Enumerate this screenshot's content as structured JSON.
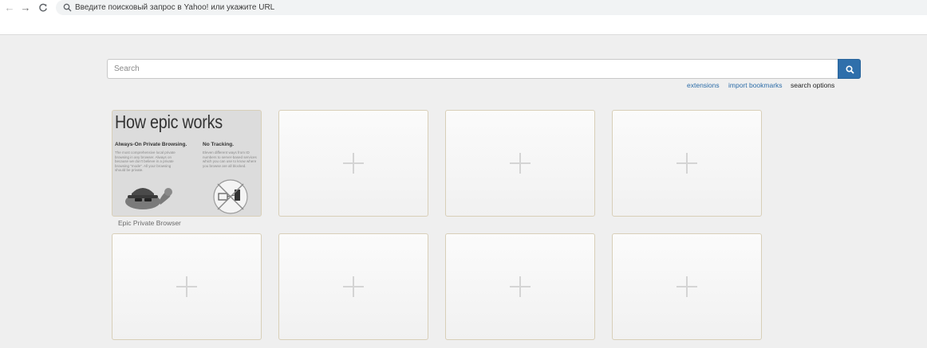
{
  "browser": {
    "address_placeholder": "Введите поисковый запрос в Yahoo! или укажите URL"
  },
  "search": {
    "placeholder": "Search"
  },
  "links": {
    "extensions": "extensions",
    "import_bookmarks": "import bookmarks",
    "search_options": "search options"
  },
  "tiles": {
    "epic": {
      "heading": "How epic works",
      "subhead_1": "Always-On Private Browsing.",
      "body_1": "The most comprehensive local private browsing in any browser. Always on because we don't believe in a private browsing \"mode\". All your browsing should be private.",
      "subhead_2": "No Tracking.",
      "body_2": "Eleven different ways from ID numbers to server-based services which you can use to know where you browse are all blocked.",
      "label": "Epic Private Browser"
    }
  },
  "colors": {
    "accent": "#2f6fab",
    "link": "#2d6da8",
    "background": "#efefef",
    "tile_border": "#d8cfb8"
  }
}
